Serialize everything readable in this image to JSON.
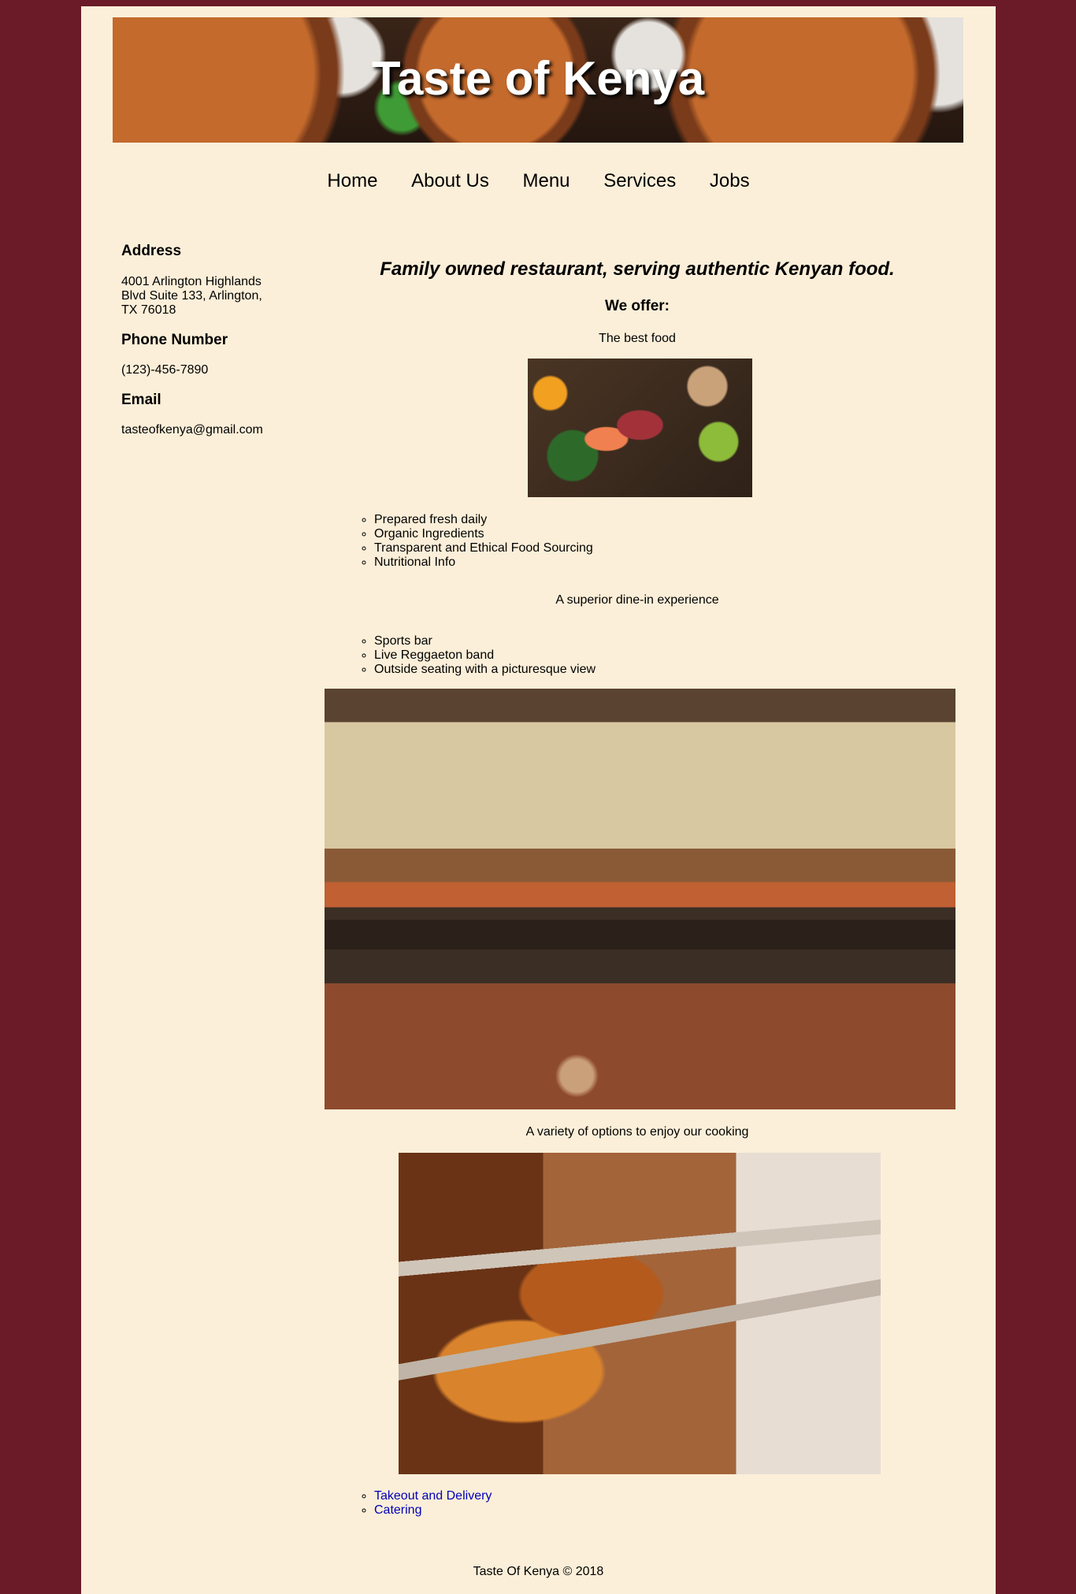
{
  "header": {
    "title": "Taste of Kenya"
  },
  "nav": {
    "items": [
      "Home",
      "About Us",
      "Menu",
      "Services",
      "Jobs"
    ]
  },
  "sidebar": {
    "address_heading": "Address",
    "address_line1": "4001 Arlington Highlands",
    "address_line2": "Blvd Suite 133, Arlington,",
    "address_line3": "TX 76018",
    "phone_heading": "Phone Number",
    "phone": "(123)-456-7890",
    "email_heading": "Email",
    "email": "tasteofkenya@gmail.com"
  },
  "main": {
    "tagline": "Family owned restaurant, serving authentic Kenyan food.",
    "offer_heading": "We offer:",
    "food_caption": "The best food",
    "food_list": [
      "Prepared fresh daily",
      "Organic Ingredients",
      "Transparent and Ethical Food Sourcing",
      "Nutritional Info"
    ],
    "dinein_caption": "A superior dine-in experience",
    "dinein_list": [
      "Sports bar",
      "Live Reggaeton band",
      "Outside seating with a picturesque view"
    ],
    "options_caption": "A variety of options to enjoy our cooking",
    "options_links": [
      "Takeout and Delivery",
      "Catering"
    ]
  },
  "footer": {
    "text": "Taste Of Kenya © 2018"
  },
  "colors": {
    "page_bg": "#6b1a28",
    "content_bg": "#fcefd9",
    "link": "#0000b8"
  }
}
